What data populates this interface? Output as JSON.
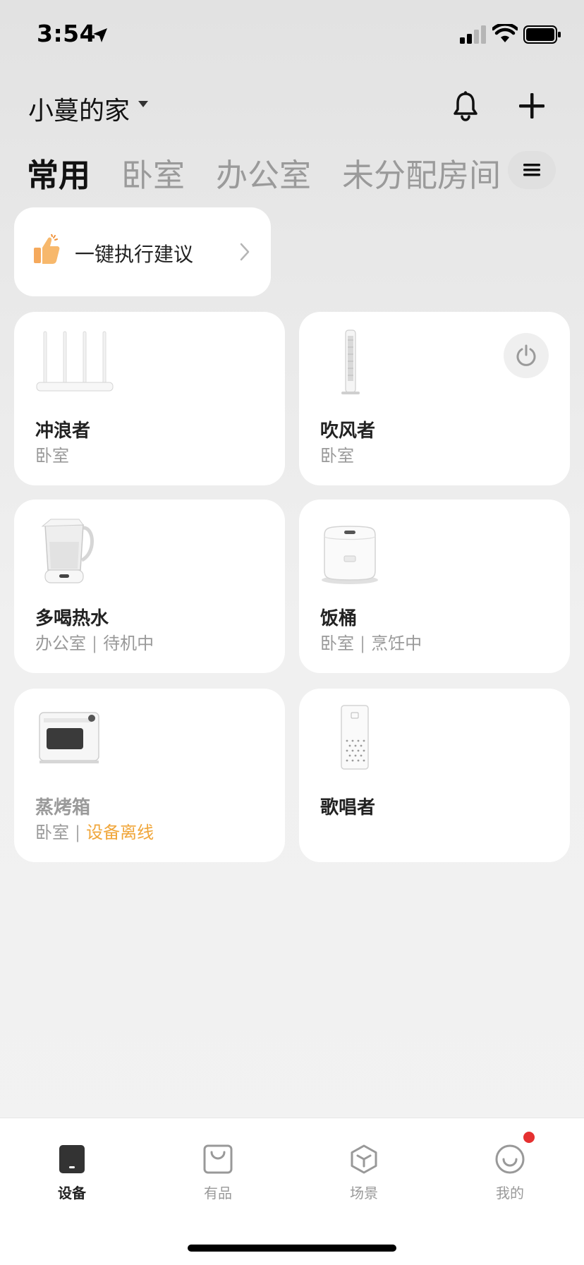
{
  "status_bar": {
    "time": "3:54"
  },
  "header": {
    "home_name": "小蔓的家"
  },
  "tabs": [
    {
      "label": "常用",
      "active": true
    },
    {
      "label": "卧室",
      "active": false
    },
    {
      "label": "办公室",
      "active": false
    },
    {
      "label": "未分配房间",
      "active": false
    }
  ],
  "suggestion": {
    "label": "一键执行建议"
  },
  "devices": [
    {
      "name": "冲浪者",
      "room": "卧室",
      "status": "",
      "icon": "router-icon"
    },
    {
      "name": "吹风者",
      "room": "卧室",
      "status": "",
      "icon": "tower-fan-icon"
    },
    {
      "name": "多喝热水",
      "room": "办公室",
      "status": "待机中",
      "icon": "kettle-icon"
    },
    {
      "name": "饭桶",
      "room": "卧室",
      "status": "烹饪中",
      "icon": "rice-cooker-icon"
    },
    {
      "name": "蒸烤箱",
      "room": "卧室",
      "status": "设备离线",
      "icon": "steam-oven-icon"
    },
    {
      "name": "歌唱者",
      "room": "",
      "status": "",
      "icon": "smart-speaker-icon"
    }
  ],
  "bottom_nav": [
    {
      "label": "设备",
      "active": true
    },
    {
      "label": "有品",
      "active": false
    },
    {
      "label": "场景",
      "active": false
    },
    {
      "label": "我的",
      "active": false
    }
  ],
  "colors": {
    "accent_warning": "#f0a63a",
    "badge": "#e53030",
    "thumb": "#f5a95c"
  }
}
